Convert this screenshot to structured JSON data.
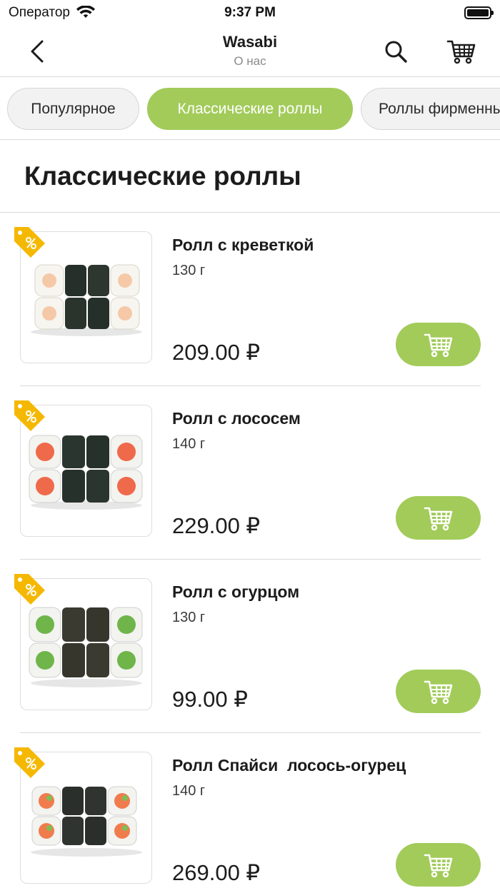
{
  "status_bar": {
    "carrier": "Оператор",
    "time": "9:37 PM"
  },
  "nav": {
    "title": "Wasabi",
    "subtitle": "О нас",
    "icons": [
      "chevron-left-icon",
      "search-icon",
      "cart-icon"
    ]
  },
  "categories": [
    {
      "label": "Популярное",
      "active": false
    },
    {
      "label": "Классические роллы",
      "active": true
    },
    {
      "label": "Роллы фирменные",
      "active": false
    }
  ],
  "section": {
    "title": "Классические роллы"
  },
  "products": [
    {
      "name": "Ролл с креветкой",
      "weight": "130 г",
      "price": "209.00 ₽",
      "filling": "shrimp",
      "has_discount_badge": true
    },
    {
      "name": "Ролл с лососем",
      "weight": "140 г",
      "price": "229.00 ₽",
      "filling": "salmon",
      "has_discount_badge": true
    },
    {
      "name": "Ролл с огурцом",
      "weight": "130 г",
      "price": "99.00 ₽",
      "filling": "cucumber",
      "has_discount_badge": true
    },
    {
      "name": "Ролл Спайси  лосось-огурец",
      "weight": "140 г",
      "price": "269.00 ₽",
      "filling": "salmon-cucumber",
      "has_discount_badge": true
    }
  ],
  "colors": {
    "accent": "#a2cb5a",
    "badge": "#f5b800",
    "text": "#1c1c1c",
    "secondary_text": "#8a8a8a"
  }
}
